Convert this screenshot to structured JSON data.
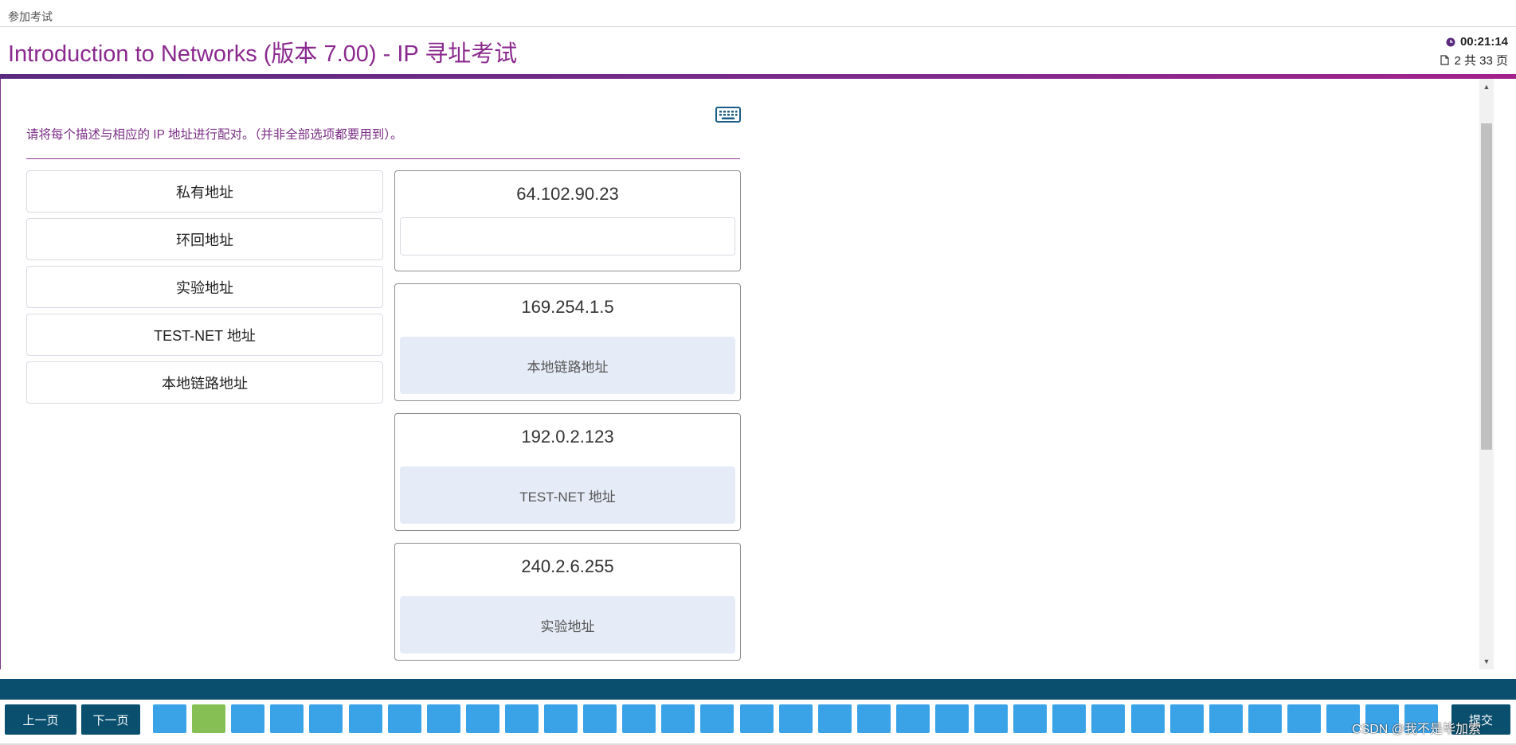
{
  "topbar": {
    "breadcrumb": "参加考试"
  },
  "header": {
    "title": "Introduction to Networks (版本 7.00) - IP 寻址考试",
    "timer": "00:21:14",
    "page_counter": "2 共 33 页"
  },
  "question": {
    "instruction": "请将每个描述与相应的 IP 地址进行配对。（并非全部选项都要用到）。",
    "options": [
      {
        "label": "私有地址"
      },
      {
        "label": "环回地址"
      },
      {
        "label": "实验地址"
      },
      {
        "label": "TEST-NET 地址"
      },
      {
        "label": "本地链路地址"
      }
    ],
    "targets": [
      {
        "ip": "64.102.90.23",
        "answer": ""
      },
      {
        "ip": "169.254.1.5",
        "answer": "本地链路地址"
      },
      {
        "ip": "192.0.2.123",
        "answer": "TEST-NET 地址"
      },
      {
        "ip": "240.2.6.255",
        "answer": "实验地址"
      }
    ]
  },
  "footer": {
    "prev_label": "上一页",
    "next_label": "下一页",
    "submit_label": "提交",
    "question_count": 33,
    "completed_index": 2
  },
  "watermark": "CSDN @我不是毕加索",
  "colors": {
    "accent_purple": "#8b2a8e",
    "teal": "#0a4f6e",
    "square_blue": "#3aa3e8",
    "square_done": "#86c055",
    "answer_bg": "#e6ecf7"
  },
  "icons": {
    "timer": "clock-icon",
    "pages": "page-icon",
    "keyboard": "keyboard-icon"
  }
}
